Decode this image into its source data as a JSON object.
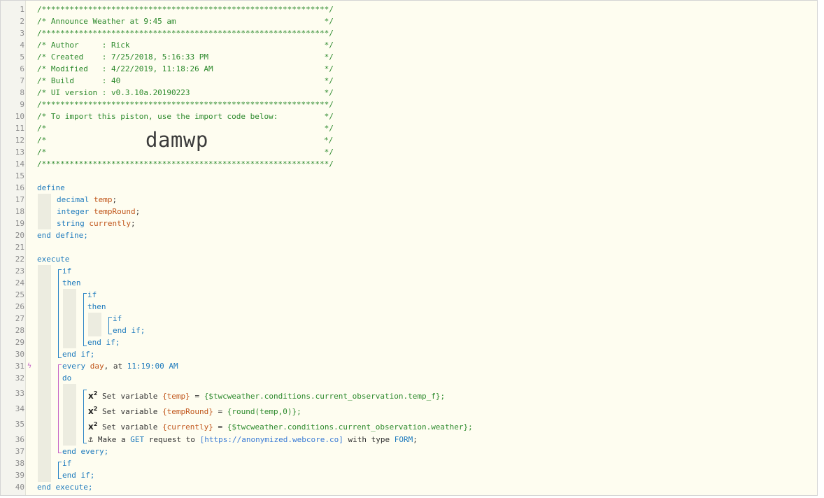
{
  "line_numbers": [
    "1",
    "2",
    "3",
    "4",
    "5",
    "6",
    "7",
    "8",
    "9",
    "10",
    "11",
    "12",
    "13",
    "14",
    "15",
    "16",
    "17",
    "18",
    "19",
    "20",
    "21",
    "22",
    "23",
    "24",
    "25",
    "26",
    "27",
    "28",
    "29",
    "30",
    "31",
    "32",
    "33",
    "34",
    "35",
    "36",
    "37",
    "38",
    "39",
    "40"
  ],
  "header": {
    "l1": "/**************************************************************/",
    "l2": "/* Announce Weather at 9:45 am                                */",
    "l3": "/**************************************************************/",
    "l4": "/* Author     : Rick                                          */",
    "l5": "/* Created    : 7/25/2018, 5:16:33 PM                         */",
    "l6": "/* Modified   : 4/22/2019, 11:18:26 AM                        */",
    "l7": "/* Build      : 40                                            */",
    "l8": "/* UI version : v0.3.10a.20190223                             */",
    "l9": "/**************************************************************/",
    "l10": "/* To import this piston, use the import code below:          */",
    "l11": "/*                                                            */",
    "l12a": "/*",
    "l12b": "*/",
    "l13": "/*                                                            */",
    "l14": "/**************************************************************/",
    "import_code": "damwp"
  },
  "define": {
    "start": "define",
    "vars": [
      {
        "type": "decimal",
        "name": "temp"
      },
      {
        "type": "integer",
        "name": "tempRound"
      },
      {
        "type": "string",
        "name": "currently"
      }
    ],
    "end": "end define;"
  },
  "execute": {
    "start": "execute",
    "kw_if": "if",
    "kw_then": "then",
    "kw_endif": "end if;",
    "every": {
      "kw": "every",
      "unit": "day",
      "at": ", at",
      "time": "11:19:00 AM",
      "do": "do",
      "end": "end every;"
    },
    "set_label": "Set variable",
    "actions": [
      {
        "var": "{temp}",
        "eq": "=",
        "value": "{$twcweather.conditions.current_observation.temp_f};"
      },
      {
        "var": "{tempRound}",
        "eq": "=",
        "value": "{round(temp,0)};"
      },
      {
        "var": "{currently}",
        "eq": "=",
        "value": "{$twcweather.conditions.current_observation.weather};"
      }
    ],
    "http": {
      "make": "Make a",
      "method": "GET",
      "req": "request to",
      "url": "[https://anonymized.webcore.co]",
      "with": "with type",
      "type": "FORM",
      "semi": ";"
    },
    "end": "end execute;"
  }
}
